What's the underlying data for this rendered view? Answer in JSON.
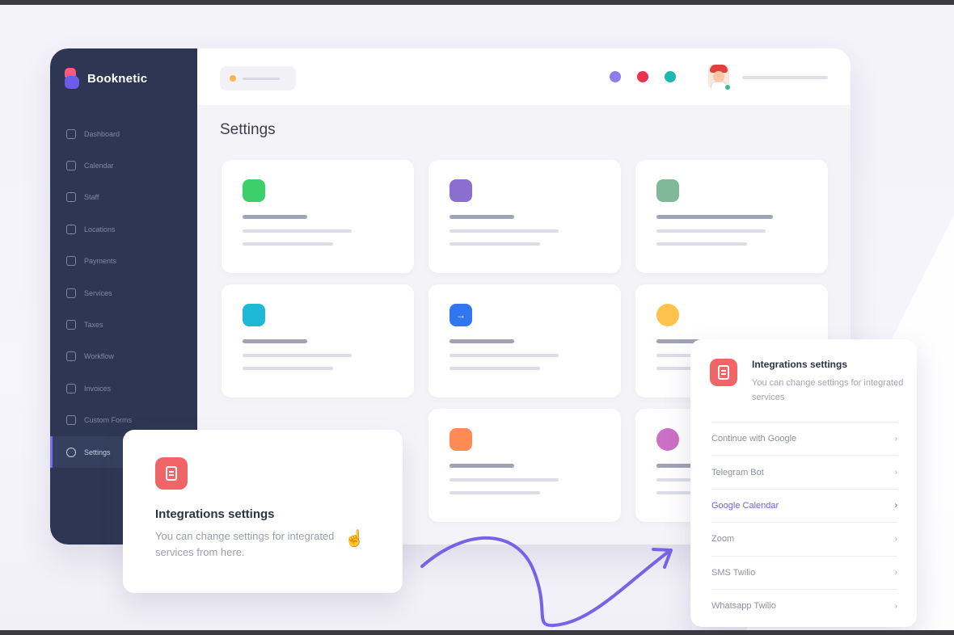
{
  "app": {
    "brand": "Booknetic",
    "page_title": "Settings"
  },
  "sidebar": {
    "items": [
      {
        "label": "Dashboard",
        "icon": "chart-line-icon"
      },
      {
        "label": "Calendar",
        "icon": "calendar-icon"
      },
      {
        "label": "Staff",
        "icon": "user-icon"
      },
      {
        "label": "Locations",
        "icon": "location-pin-icon"
      },
      {
        "label": "Payments",
        "icon": "payments-icon"
      },
      {
        "label": "Services",
        "icon": "services-icon"
      },
      {
        "label": "Taxes",
        "icon": "taxes-icon"
      },
      {
        "label": "Workflow",
        "icon": "workflow-icon"
      },
      {
        "label": "Invoices",
        "icon": "invoices-icon"
      },
      {
        "label": "Custom Forms",
        "icon": "custom-forms-icon"
      },
      {
        "label": "Settings",
        "icon": "gear-icon",
        "active": true
      }
    ]
  },
  "topbar": {
    "status_dots": [
      "#8d7df0",
      "#e8344e",
      "#1fb7b0"
    ]
  },
  "cards": [
    {
      "icon_color": "#3ccf6a",
      "icon": "whatsapp-icon"
    },
    {
      "icon_color": "#8b6fd0",
      "icon": "brush-icon"
    },
    {
      "icon_color": "#7fb99a",
      "icon": "clock-icon"
    },
    {
      "icon_color": "#1fb7d6",
      "icon": "window-icon"
    },
    {
      "icon_color": "#2f76f0",
      "icon": "arrow-right-icon"
    },
    {
      "icon_color": "#ffc24d",
      "icon": "circle-icon"
    },
    {
      "icon_color": "#ff8a55",
      "icon": "tag-icon"
    },
    {
      "icon_color": "#cd6fc6",
      "icon": "circle-icon"
    }
  ],
  "integrations_card": {
    "title": "Integrations settings",
    "description": "You can change settings for integrated services from here."
  },
  "integrations_panel": {
    "title": "Integrations settings",
    "description": "You can change settings for integrated services",
    "items": [
      {
        "label": "Continue with Google",
        "active": false
      },
      {
        "label": "Telegram Bot",
        "active": false
      },
      {
        "label": "Google Calendar",
        "active": true
      },
      {
        "label": "Zoom",
        "active": false
      },
      {
        "label": "SMS Twilio",
        "active": false
      },
      {
        "label": "Whatsapp Twilio",
        "active": false
      }
    ]
  },
  "colors": {
    "sidebar_bg": "#2d3753",
    "accent": "#7b6cf0",
    "integration_icon": "#f06565"
  }
}
